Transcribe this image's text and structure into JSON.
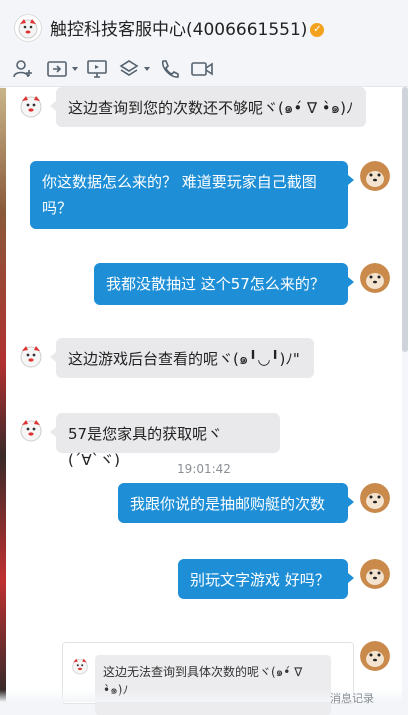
{
  "window": {
    "title": "触控科技客服中心(4006661551)",
    "verified_badge": "✓"
  },
  "toolbar": {
    "icons": [
      "add-friend-icon",
      "share-screen-icon",
      "remote-desktop-icon",
      "app-icon",
      "phone-icon",
      "video-icon"
    ]
  },
  "colors": {
    "outgoing_bubble": "#1e8fd7",
    "incoming_bubble": "#e9e9eb",
    "verified": "#f4a21e"
  },
  "messages": [
    {
      "dir": "in",
      "text": "这边查询到您的次数还不够呢ヾ(๑•́ ∇ •̀๑)ﾉ"
    },
    {
      "dir": "out",
      "text": "你这数据怎么来的？ 难道要玩家自己截图吗？"
    },
    {
      "dir": "out",
      "text": "我都没散抽过 这个57怎么来的？"
    },
    {
      "dir": "in",
      "text": "这边游戏后台查看的呢ヾ(๑╹◡╹)ﾉ\""
    },
    {
      "dir": "in",
      "text": "57是您家具的获取呢ヾ(´∀`ヾ)"
    },
    {
      "dir": "out",
      "text": "我跟你说的是抽邮购艇的次数"
    },
    {
      "dir": "out",
      "text": "别玩文字游戏 好吗？"
    }
  ],
  "timestamp": "19:01:42",
  "quote": {
    "text": "这边无法查询到具体次数的呢ヾ(๑•́ ∇ •̀๑)ﾉ"
  },
  "bottom_partial": "消息记录"
}
